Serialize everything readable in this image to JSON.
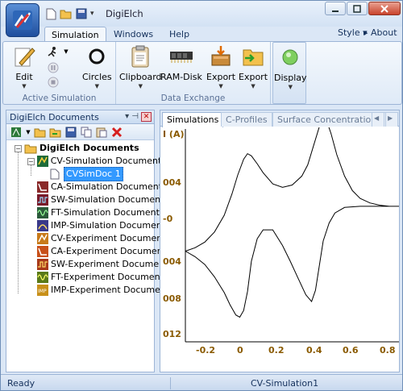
{
  "window": {
    "title": "DigiElch"
  },
  "ribbon_tabs": [
    "Simulation",
    "Windows",
    "Help"
  ],
  "ribbon_right": {
    "style": "Style",
    "about": "About"
  },
  "ribbon_groups": {
    "active_simulation": {
      "label": "Active Simulation",
      "edit": "Edit",
      "circles": "Circles"
    },
    "data_exchange": {
      "label": "Data Exchange",
      "clipboard": "Clipboard",
      "ram_disk": "RAM-Disk",
      "export1": "Export",
      "export2": "Export"
    },
    "display": {
      "label": "Display"
    }
  },
  "left_panel": {
    "title": "DigiElch Documents",
    "tree": {
      "root": "DigiElch Documents",
      "cv_sim": "CV-Simulation Documents",
      "cv_sim_doc": "CVSimDoc 1",
      "ca_sim": "CA-Simulation Documents",
      "sw_sim": "SW-Simulation Documents",
      "ft_sim": "FT-Simulation Documents",
      "imp_sim": "IMP-Simulation Documents",
      "cv_exp": "CV-Experiment Documents",
      "ca_exp": "CA-Experiment Documents",
      "sw_exp": "SW-Experiment Documents",
      "ft_exp": "FT-Experiment Documents",
      "imp_exp": "IMP-Experiment Documents"
    }
  },
  "doc_tabs": [
    "Simulations",
    "C-Profiles",
    "Surface Concentrations"
  ],
  "plot": {
    "ylabel": "I (A)",
    "xticks": [
      "-0.2",
      "0",
      "0.2",
      "0.4",
      "0.6",
      "0.8"
    ],
    "yticks": [
      "004",
      "-0",
      "004",
      "008",
      "012"
    ]
  },
  "status": {
    "left": "Ready",
    "mid": "CV-Simulation1"
  },
  "chart_data": {
    "type": "line",
    "ylabel": "I (A)",
    "xlim": [
      -0.3,
      0.8
    ],
    "ylim": [
      -0.0012,
      0.0007
    ],
    "xticks": [
      -0.2,
      0,
      0.2,
      0.4,
      0.6,
      0.8
    ],
    "series": [
      {
        "x": [
          -0.3,
          -0.25,
          -0.2,
          -0.15,
          -0.1,
          -0.06,
          -0.03,
          0.0,
          0.02,
          0.04,
          0.07,
          0.1,
          0.15,
          0.2,
          0.25,
          0.3,
          0.33,
          0.36,
          0.39,
          0.41,
          0.43,
          0.45,
          0.48,
          0.52,
          0.56,
          0.6,
          0.65,
          0.7,
          0.75,
          0.8,
          0.8,
          0.7,
          0.6,
          0.52,
          0.47,
          0.44,
          0.41,
          0.39,
          0.37,
          0.35,
          0.32,
          0.28,
          0.24,
          0.2,
          0.15,
          0.1,
          0.07,
          0.04,
          0.02,
          0.0,
          -0.02,
          -0.04,
          -0.07,
          -0.1,
          -0.15,
          -0.2,
          -0.25,
          -0.3
        ],
        "y": [
          -0.00039,
          -0.00036,
          -0.00031,
          -0.00022,
          -7e-05,
          0.00012,
          0.00029,
          0.00043,
          0.00048,
          0.00046,
          0.00039,
          0.00031,
          0.00021,
          0.00018,
          0.0002,
          0.00028,
          0.00038,
          0.00055,
          0.00072,
          0.00078,
          0.00076,
          0.00066,
          0.00047,
          0.00028,
          0.00015,
          8e-05,
          4e-05,
          2e-05,
          1e-05,
          1e-05,
          1e-05,
          1e-05,
          1e-05,
          0.0,
          -5e-05,
          -0.00014,
          -0.0003,
          -0.00052,
          -0.00074,
          -0.00084,
          -0.00078,
          -0.00063,
          -0.00048,
          -0.00034,
          -0.0002,
          -0.0002,
          -0.00028,
          -0.00048,
          -0.00075,
          -0.00092,
          -0.00098,
          -0.00096,
          -0.00087,
          -0.00076,
          -0.00062,
          -0.00051,
          -0.00044,
          -0.00039
        ]
      }
    ]
  }
}
